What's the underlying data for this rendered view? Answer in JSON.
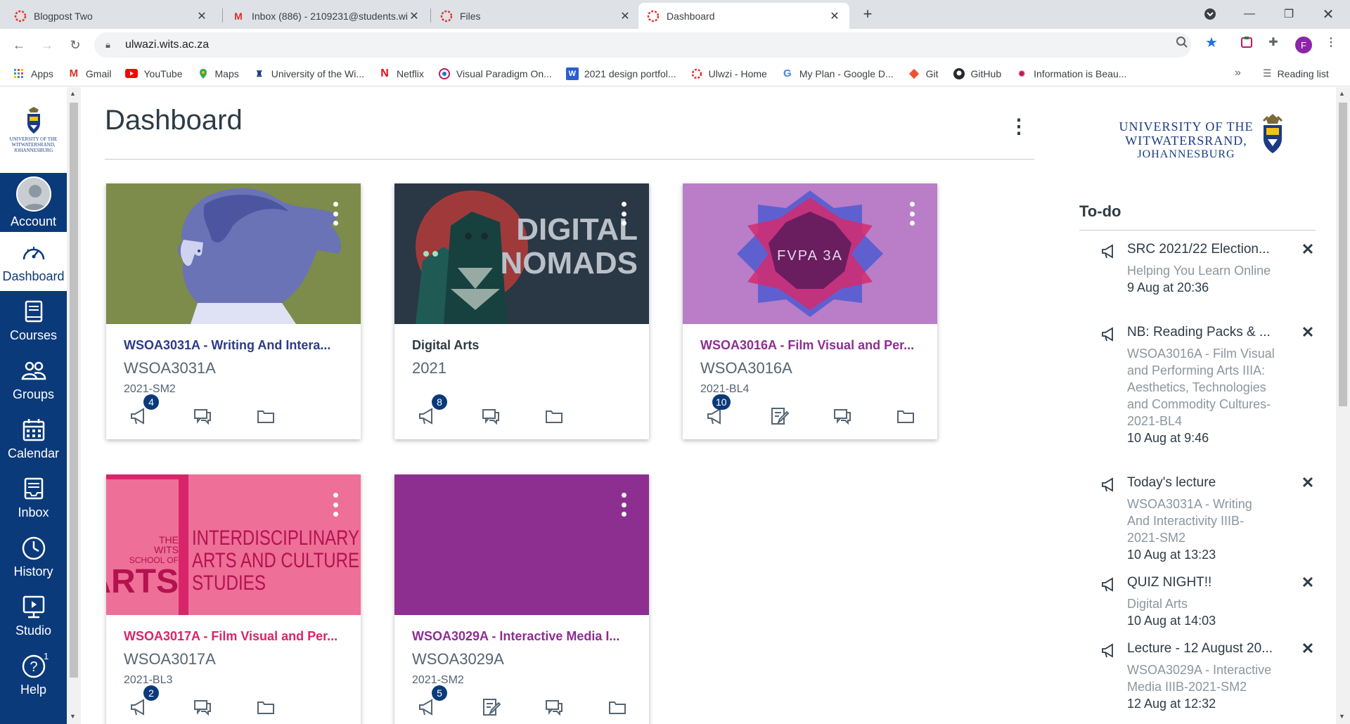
{
  "browser": {
    "tabs": [
      {
        "title": "Blogpost Two",
        "active": false
      },
      {
        "title": "Inbox (886) - 2109231@students.wits.ac.za",
        "active": false
      },
      {
        "title": "Files",
        "active": false
      },
      {
        "title": "Dashboard",
        "active": true
      }
    ],
    "url": "ulwazi.wits.ac.za",
    "profile_initial": "F",
    "bookmarks": [
      {
        "label": "Apps",
        "icon": "apps-grid-icon"
      },
      {
        "label": "Gmail",
        "icon": "gmail-icon"
      },
      {
        "label": "YouTube",
        "icon": "youtube-icon"
      },
      {
        "label": "Maps",
        "icon": "maps-icon"
      },
      {
        "label": "University of the Wi...",
        "icon": "wits-crest-icon"
      },
      {
        "label": "Netflix",
        "icon": "netflix-icon"
      },
      {
        "label": "Visual Paradigm On...",
        "icon": "visual-paradigm-icon"
      },
      {
        "label": "2021 design portfol...",
        "icon": "weebly-icon"
      },
      {
        "label": "Ulwzi - Home",
        "icon": "canvas-icon"
      },
      {
        "label": "My Plan - Google D...",
        "icon": "google-icon"
      },
      {
        "label": "Git",
        "icon": "git-icon"
      },
      {
        "label": "GitHub",
        "icon": "github-icon"
      },
      {
        "label": "Information is Beau...",
        "icon": "info-beautiful-icon"
      }
    ],
    "more_bookmarks": "»",
    "reading_list": "Reading list"
  },
  "global_nav": {
    "logo_text": "UNIVERSITY OF THE WITWATERSRAND, JOHANNESBURG",
    "items": [
      {
        "label": "Account",
        "icon": "avatar"
      },
      {
        "label": "Dashboard",
        "icon": "dashboard-gauge-icon"
      },
      {
        "label": "Courses",
        "icon": "courses-book-icon"
      },
      {
        "label": "Groups",
        "icon": "groups-people-icon"
      },
      {
        "label": "Calendar",
        "icon": "calendar-icon"
      },
      {
        "label": "Inbox",
        "icon": "inbox-tray-icon"
      },
      {
        "label": "History",
        "icon": "clock-icon"
      },
      {
        "label": "Studio",
        "icon": "studio-screen-icon"
      },
      {
        "label": "Help",
        "icon": "help-question-icon",
        "badge": "1"
      }
    ]
  },
  "dashboard": {
    "title": "Dashboard",
    "cards": [
      {
        "name": "WSOA3031A - Writing And Intera...",
        "code": "WSOA3031A",
        "term": "2021-SM2",
        "color": "#2d3b87",
        "hero": "olive-illustration",
        "badge": "4",
        "actions": [
          "announcements",
          "discussions",
          "files"
        ]
      },
      {
        "name": "Digital Arts",
        "code": "2021",
        "term": "",
        "color": "#2d3b45",
        "hero": "digital-nomads",
        "hero_text": [
          "DIGITAL",
          "NOMADS"
        ],
        "badge": "8",
        "actions": [
          "announcements",
          "discussions",
          "files"
        ]
      },
      {
        "name": "WSOA3016A - Film Visual and Per...",
        "code": "WSOA3016A",
        "term": "2021-BL4",
        "color": "#8d2e91",
        "hero": "fvpa",
        "hero_text": [
          "FVPA 3A"
        ],
        "badge": "10",
        "actions": [
          "announcements",
          "assignments",
          "discussions",
          "files"
        ]
      },
      {
        "name": "WSOA3017A - Film Visual and Per...",
        "code": "WSOA3017A",
        "term": "2021-BL3",
        "color": "#d8256a",
        "hero": "wits-arts",
        "hero_text": [
          "THE",
          "WITS",
          "SCHOOL OF",
          "ARTS",
          "INTERDISCIPLINARY",
          "ARTS AND CULTURE",
          "STUDIES"
        ],
        "badge": "2",
        "actions": [
          "announcements",
          "discussions",
          "files"
        ]
      },
      {
        "name": "WSOA3029A - Interactive Media I...",
        "code": "WSOA3029A",
        "term": "2021-SM2",
        "color": "#8d2e91",
        "hero": "purple-solid",
        "badge": "5",
        "actions": [
          "announcements",
          "assignments",
          "discussions",
          "files"
        ]
      }
    ]
  },
  "sidebar": {
    "logo_lines": [
      "UNIVERSITY OF THE",
      "WITWATERSRAND,",
      "JOHANNESBURG"
    ],
    "todo_title": "To-do",
    "todos": [
      {
        "title": "SRC 2021/22 Election...",
        "course": "Helping You Learn Online",
        "due": "9 Aug at 20:36"
      },
      {
        "title": "NB: Reading Packs & ...",
        "course": "WSOA3016A - Film Visual and Performing Arts IIIA: Aesthetics, Technologies and Commodity Cultures-2021-BL4",
        "due": "10 Aug at 9:46"
      },
      {
        "title": "Today's lecture",
        "course": "WSOA3031A - Writing And Interactivity IIIB-2021-SM2",
        "due": "10 Aug at 13:23"
      },
      {
        "title": "QUIZ NIGHT!!",
        "course": "Digital Arts",
        "due": "10 Aug at 14:03"
      },
      {
        "title": "Lecture - 12 August 20...",
        "course": "WSOA3029A - Interactive Media IIIB-2021-SM2",
        "due": "12 Aug at 12:32"
      }
    ]
  },
  "colors": {
    "nav_bg": "#0b3a7a",
    "olive": "#7d8c4a",
    "digital_bg": "#2a3745",
    "fvpa_bg": "#b97ec7",
    "arts_pink": "#ee6f98",
    "purple": "#8d2e91"
  }
}
